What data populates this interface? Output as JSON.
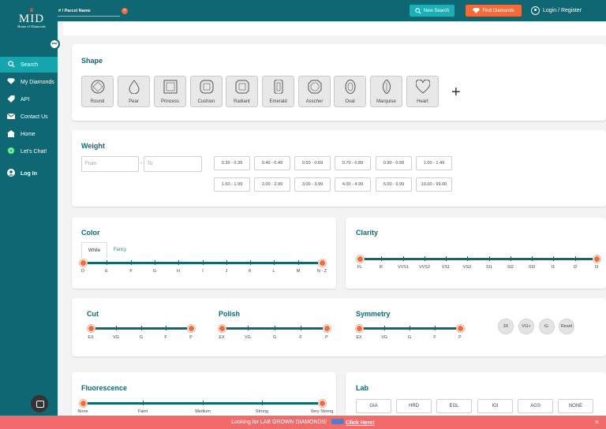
{
  "header": {
    "search_placeholder": "# / Parcel Name",
    "new_search_label": "New Search",
    "find_diamonds_label": "Find Diamonds",
    "login_register_label": "Login / Register"
  },
  "brand": {
    "logo_text": "MID",
    "logo_subtitle": "Home of Diamonds"
  },
  "sidebar": {
    "items": [
      {
        "label": "Search",
        "icon": "search-icon"
      },
      {
        "label": "My Diamonds",
        "icon": "diamond-icon"
      },
      {
        "label": "API",
        "icon": "api-icon"
      },
      {
        "label": "Contact Us",
        "icon": "envelope-icon"
      },
      {
        "label": "Home",
        "icon": "home-icon"
      },
      {
        "label": "Let's Chat!",
        "icon": "whatsapp-icon"
      },
      {
        "label": "Log In",
        "icon": "user-icon"
      }
    ]
  },
  "shape": {
    "title": "Shape",
    "items": [
      "Round",
      "Pear",
      "Princess",
      "Cushion",
      "Radiant",
      "Emerald",
      "Asscher",
      "Oval",
      "Marquise",
      "Heart"
    ],
    "more_label": "+"
  },
  "weight": {
    "title": "Weight",
    "from_placeholder": "From",
    "to_placeholder": "To",
    "dash": "-",
    "ranges": [
      [
        "0.30 - 0.39",
        "0.40 - 0.49",
        "0.50 - 0.69",
        "0.70 - 0.89",
        "0.90 - 0.99",
        "1.00 - 1.49"
      ],
      [
        "1.50 - 1.99",
        "2.00 - 2.99",
        "3.00 - 3.99",
        "4.00 - 4.99",
        "5.00 - 9.99",
        "10.00 - 99.00"
      ]
    ]
  },
  "color": {
    "title": "Color",
    "tabs": [
      "White",
      "Fancy"
    ],
    "active_tab": "White",
    "grades": [
      "D",
      "E",
      "F",
      "G",
      "H",
      "I",
      "J",
      "K",
      "L",
      "M",
      "N - Z"
    ]
  },
  "clarity": {
    "title": "Clarity",
    "grades": [
      "FL",
      "IF",
      "VVS1",
      "VVS2",
      "VS1",
      "VS2",
      "SI1",
      "SI2",
      "SI3",
      "I1",
      "I2",
      "I3"
    ]
  },
  "cut": {
    "title": "Cut",
    "grades": [
      "EX",
      "VG",
      "G",
      "F",
      "P"
    ]
  },
  "polish": {
    "title": "Polish",
    "grades": [
      "EX",
      "VG",
      "G",
      "F",
      "P"
    ]
  },
  "symmetry": {
    "title": "Symmetry",
    "grades": [
      "EX",
      "VG",
      "G",
      "F",
      "P"
    ]
  },
  "quick_buttons": [
    "3X",
    "VG+",
    "G-",
    "Reset"
  ],
  "fluorescence": {
    "title": "Fluorescence",
    "grades": [
      "None",
      "Faint",
      "Medium",
      "Strong",
      "Very Strong"
    ]
  },
  "lab": {
    "title": "Lab",
    "items": [
      "GIA",
      "HRD",
      "EGL",
      "IGI",
      "AGS",
      "NONE"
    ]
  },
  "banner": {
    "text": "Looking for LAB GROWN DIAMONDS!",
    "link": "Click Here!",
    "close": "×"
  },
  "colors": {
    "primary": "#0e6772",
    "accent": "#f26b3a",
    "teal_button": "#1ab0b5",
    "banner": "#f26b6b"
  }
}
